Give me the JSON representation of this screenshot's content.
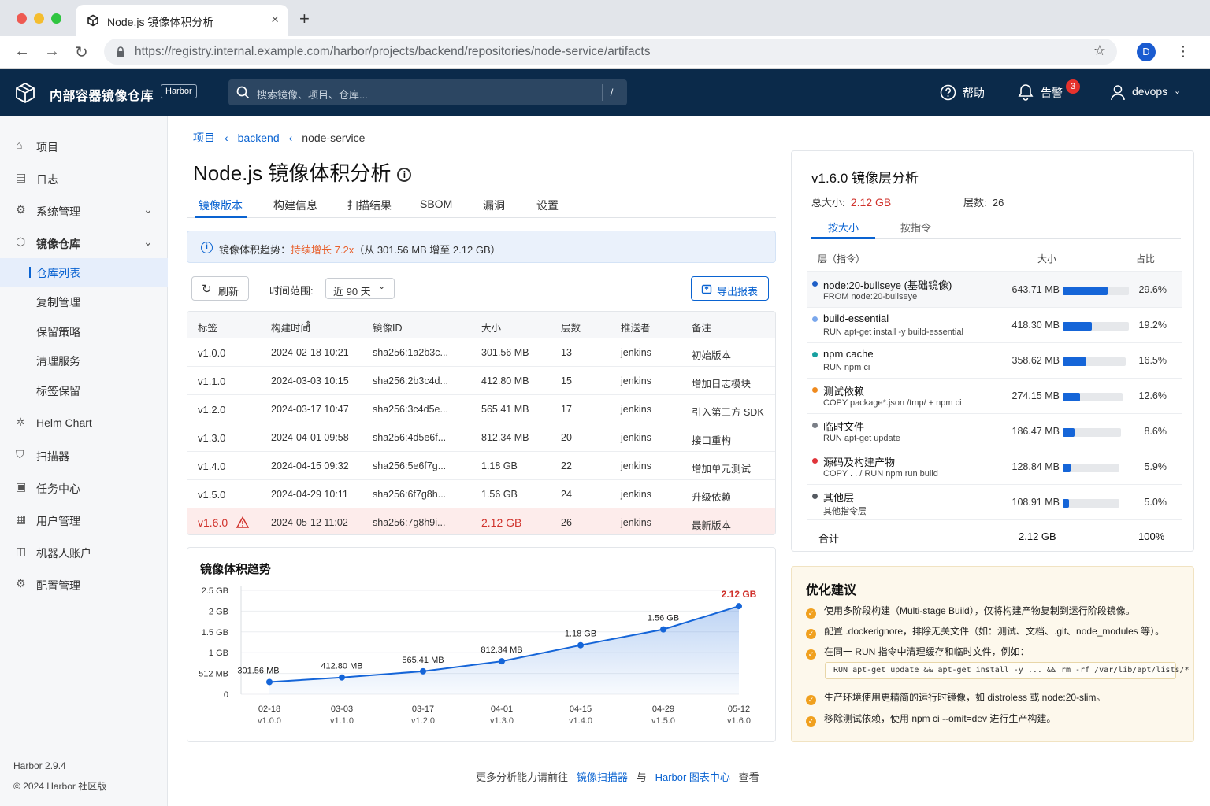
{
  "browser": {
    "tab_title": "Node.js 镜像体积分析",
    "url_host": "https://registry.internal.example.com",
    "url_path": "/harbor/projects/backend/repositories/node-service/artifacts",
    "profile_initial": "D"
  },
  "header": {
    "brand": "内部容器镜像仓库",
    "brand_tag": "Harbor",
    "search_placeholder": "搜索镜像、项目、仓库...",
    "search_shortcut": "/",
    "help": "帮助",
    "alerts": "告警",
    "alerts_count": "3",
    "user": "devops"
  },
  "sidebar": {
    "items": [
      {
        "label": "项目",
        "icon": "home-icon"
      },
      {
        "label": "日志",
        "icon": "log-icon"
      },
      {
        "label": "系统管理",
        "icon": "gear-icon"
      },
      {
        "label": "镜像仓库",
        "icon": "cube-icon"
      },
      {
        "label": "Helm Chart",
        "icon": "helm-icon"
      },
      {
        "label": "扫描器",
        "icon": "shield-icon"
      },
      {
        "label": "任务中心",
        "icon": "task-icon"
      },
      {
        "label": "用户管理",
        "icon": "users-icon"
      },
      {
        "label": "机器人账户",
        "icon": "robot-icon"
      },
      {
        "label": "配置管理",
        "icon": "settings-icon"
      }
    ],
    "sub_items": [
      "仓库列表",
      "复制管理",
      "保留策略",
      "清理服务",
      "标签保留"
    ],
    "version": "Harbor 2.9.4",
    "copyright": "© 2024 Harbor 社区版"
  },
  "breadcrumb": {
    "root": "项目",
    "project": "backend",
    "repo": "node-service"
  },
  "page_title": "Node.js 镜像体积分析",
  "tabs": [
    "镜像版本",
    "构建信息",
    "扫描结果",
    "SBOM",
    "漏洞",
    "设置"
  ],
  "alert": {
    "prefix": "镜像体积趋势：",
    "highlight": "持续增长 7.2x",
    "suffix": "（从 301.56 MB 增至 2.12 GB）"
  },
  "toolbar": {
    "refresh": "刷新",
    "range_label": "时间范围:",
    "range_value": "近 90 天",
    "export": "导出报表"
  },
  "table": {
    "headers": [
      "标签",
      "构建时间",
      "镜像ID",
      "大小",
      "层数",
      "推送者",
      "备注"
    ],
    "rows": [
      [
        "v1.0.0",
        "2024-02-18 10:21",
        "sha256:1a2b3c...",
        "301.56 MB",
        "13",
        "jenkins",
        "初始版本"
      ],
      [
        "v1.1.0",
        "2024-03-03 10:15",
        "sha256:2b3c4d...",
        "412.80 MB",
        "15",
        "jenkins",
        "增加日志模块"
      ],
      [
        "v1.2.0",
        "2024-03-17 10:47",
        "sha256:3c4d5e...",
        "565.41 MB",
        "17",
        "jenkins",
        "引入第三方 SDK"
      ],
      [
        "v1.3.0",
        "2024-04-01 09:58",
        "sha256:4d5e6f...",
        "812.34 MB",
        "20",
        "jenkins",
        "接口重构"
      ],
      [
        "v1.4.0",
        "2024-04-15 09:32",
        "sha256:5e6f7g...",
        "1.18 GB",
        "22",
        "jenkins",
        "增加单元测试"
      ],
      [
        "v1.5.0",
        "2024-04-29 10:11",
        "sha256:6f7g8h...",
        "1.56 GB",
        "24",
        "jenkins",
        "升级依赖"
      ],
      [
        "v1.6.0",
        "2024-05-12 11:02",
        "sha256:7g8h9i...",
        "2.12 GB",
        "26",
        "jenkins",
        "最新版本"
      ]
    ]
  },
  "chart_data": {
    "type": "area",
    "title": "镜像体积趋势",
    "x": [
      "02-18",
      "03-03",
      "03-17",
      "04-01",
      "04-15",
      "04-29",
      "05-12"
    ],
    "x_sub": [
      "v1.0.0",
      "v1.1.0",
      "v1.2.0",
      "v1.3.0",
      "v1.4.0",
      "v1.5.0",
      "v1.6.0"
    ],
    "values_mb": [
      301.56,
      412.8,
      565.41,
      812.34,
      1208.32,
      1597.44,
      2170.88
    ],
    "value_labels": [
      "301.56 MB",
      "412.80 MB",
      "565.41 MB",
      "812.34 MB",
      "1.18 GB",
      "1.56 GB",
      "2.12 GB"
    ],
    "y_ticks": [
      "2.5 GB",
      "2 GB",
      "1.5 GB",
      "1 GB",
      "512 MB",
      "0"
    ],
    "y_tick_values_mb": [
      2560,
      2048,
      1536,
      1024,
      512,
      0
    ],
    "ylim_mb": [
      0,
      2560
    ],
    "color": "#1565d8",
    "highlight_color": "#d0312b"
  },
  "layers": {
    "title": "v1.6.0 镜像层分析",
    "total_label": "总大小:",
    "total": "2.12 GB",
    "count_label": "层数:",
    "count": "26",
    "tabs": [
      "按大小",
      "按指令"
    ],
    "headers": [
      "层（指令）",
      "大小",
      "占比"
    ],
    "rows": [
      {
        "name": "node:20-bullseye (基础镜像)",
        "cmd": "FROM node:20-bullseye",
        "size": "643.71 MB",
        "pct": "29.6%",
        "frac": 0.296,
        "color": "#1f5fc7"
      },
      {
        "name": "build-essential",
        "cmd": "RUN apt-get install -y build-essential",
        "size": "418.30 MB",
        "pct": "19.2%",
        "frac": 0.192,
        "color": "#7aa7ec"
      },
      {
        "name": "npm cache",
        "cmd": "RUN npm ci",
        "size": "358.62 MB",
        "pct": "16.5%",
        "frac": 0.165,
        "color": "#17a0a0"
      },
      {
        "name": "测试依赖",
        "cmd": "COPY package*.json /tmp/ + npm ci",
        "size": "274.15 MB",
        "pct": "12.6%",
        "frac": 0.126,
        "color": "#ef8a1e"
      },
      {
        "name": "临时文件",
        "cmd": "RUN apt-get update",
        "size": "186.47 MB",
        "pct": "8.6%",
        "frac": 0.086,
        "color": "#7a7f87"
      },
      {
        "name": "源码及构建产物",
        "cmd": "COPY . . / RUN npm run build",
        "size": "128.84 MB",
        "pct": "5.9%",
        "frac": 0.059,
        "color": "#e0343a"
      },
      {
        "name": "其他层",
        "cmd": "其他指令层",
        "size": "108.91 MB",
        "pct": "5.0%",
        "frac": 0.05,
        "color": "#555a61"
      }
    ],
    "sum_label": "合计",
    "sum_size": "2.12 GB",
    "sum_pct": "100%"
  },
  "tips": {
    "title": "优化建议",
    "items": [
      "使用多阶段构建（Multi-stage Build），仅将构建产物复制到运行阶段镜像。",
      "配置 .dockerignore，排除无关文件（如：测试、文档、.git、node_modules 等）。",
      "在同一 RUN 指令中清理缓存和临时文件，例如：",
      "生产环境使用更精简的运行时镜像，如 distroless 或 node:20-slim。",
      "移除测试依赖，使用 npm ci --omit=dev 进行生产构建。"
    ],
    "code": "RUN apt-get update && apt-get install -y ... && rm -rf /var/lib/apt/lists/*"
  },
  "footer": {
    "prefix": "更多分析能力请前往",
    "link1": "镜像扫描器",
    "mid": "与",
    "link2": "Harbor 图表中心",
    "suffix": "查看"
  }
}
